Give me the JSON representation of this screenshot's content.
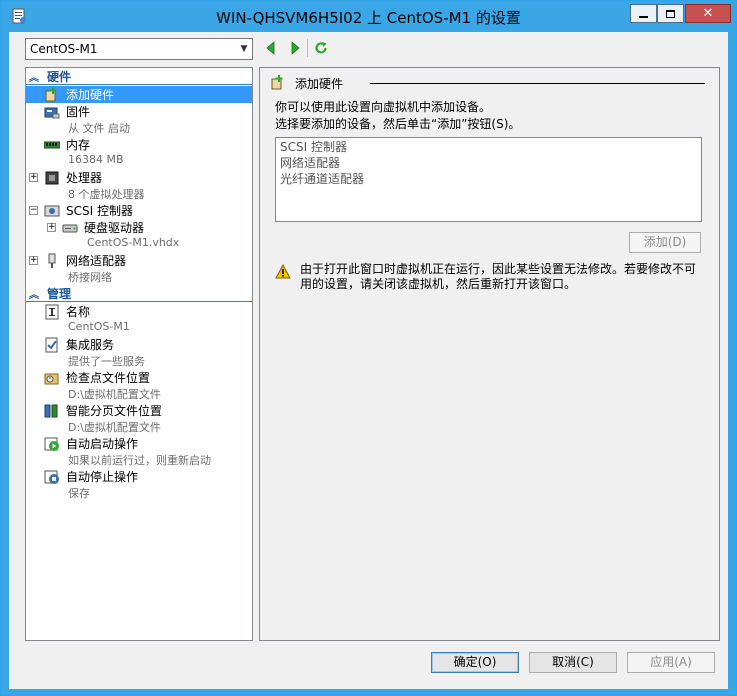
{
  "window": {
    "title": "WIN-QHSVM6H5I02 上 CentOS-M1 的设置",
    "frame_color": "#3aa6e6"
  },
  "toolbar": {
    "vm_selected": "CentOS-M1",
    "back_icon": "green-left-arrow",
    "forward_icon": "green-right-arrow",
    "refresh_icon": "green-refresh"
  },
  "tree": {
    "hardware_header": "硬件",
    "management_header": "管理",
    "hardware": [
      {
        "label": "添加硬件",
        "sub": "",
        "icon": "add-hardware-icon",
        "selected": true
      },
      {
        "label": "固件",
        "sub": "从 文件 启动",
        "icon": "firmware-icon"
      },
      {
        "label": "内存",
        "sub": "16384 MB",
        "icon": "memory-icon"
      },
      {
        "label": "处理器",
        "sub": "8 个虚拟处理器",
        "icon": "processor-icon"
      },
      {
        "label": "SCSI 控制器",
        "sub": "",
        "icon": "scsi-icon"
      },
      {
        "label": "硬盘驱动器",
        "sub": "CentOS-M1.vhdx",
        "icon": "hard-drive-icon"
      },
      {
        "label": "网络适配器",
        "sub": "桥接网络",
        "icon": "network-adapter-icon"
      }
    ],
    "management": [
      {
        "label": "名称",
        "sub": "CentOS-M1",
        "icon": "name-icon"
      },
      {
        "label": "集成服务",
        "sub": "提供了一些服务",
        "icon": "integration-services-icon"
      },
      {
        "label": "检查点文件位置",
        "sub": "D:\\虚拟机配置文件",
        "icon": "checkpoint-icon"
      },
      {
        "label": "智能分页文件位置",
        "sub": "D:\\虚拟机配置文件",
        "icon": "paging-icon"
      },
      {
        "label": "自动启动操作",
        "sub": "如果以前运行过，则重新启动",
        "icon": "auto-start-icon"
      },
      {
        "label": "自动停止操作",
        "sub": "保存",
        "icon": "auto-stop-icon"
      }
    ]
  },
  "content": {
    "header": "添加硬件",
    "desc1": "你可以使用此设置向虚拟机中添加设备。",
    "desc2": "选择要添加的设备，然后单击“添加”按钮(S)。",
    "devices": [
      "SCSI 控制器",
      "网络适配器",
      "光纤通道适配器"
    ],
    "add_button": "添加(D)",
    "warning": "由于打开此窗口时虚拟机正在运行，因此某些设置无法修改。若要修改不可用的设置，请关闭该虚拟机，然后重新打开该窗口。"
  },
  "buttons": {
    "ok": "确定(O)",
    "cancel": "取消(C)",
    "apply": "应用(A)"
  }
}
